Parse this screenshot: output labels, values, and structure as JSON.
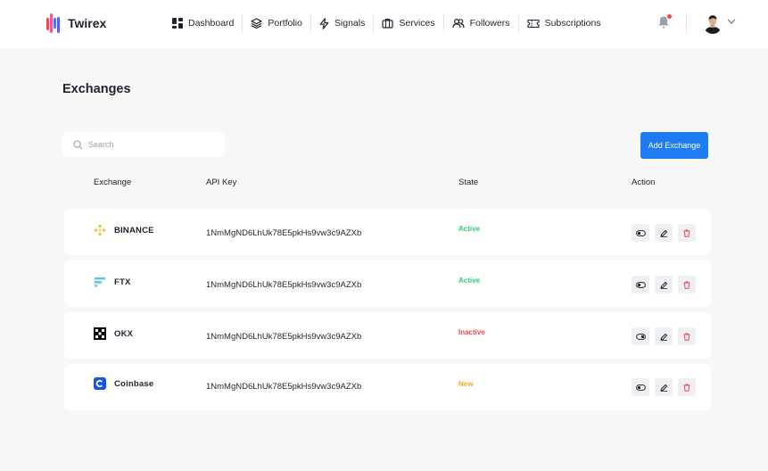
{
  "brand": {
    "name": "Twirex"
  },
  "nav": {
    "items": [
      {
        "label": "Dashboard",
        "icon": "dashboard-icon"
      },
      {
        "label": "Portfolio",
        "icon": "layers-icon"
      },
      {
        "label": "Signals",
        "icon": "lightning-icon"
      },
      {
        "label": "Services",
        "icon": "briefcase-icon"
      },
      {
        "label": "Followers",
        "icon": "users-icon"
      },
      {
        "label": "Subscriptions",
        "icon": "ticket-icon"
      }
    ]
  },
  "header": {
    "notification_icon": "bell-icon",
    "has_unread": true,
    "profile_icon": "avatar",
    "menu_icon": "chevron-down-icon"
  },
  "page": {
    "title": "Exchanges"
  },
  "search": {
    "placeholder": "Search",
    "value": ""
  },
  "toolbar": {
    "add_label": "Add Exchange"
  },
  "table": {
    "columns": [
      "Exchange",
      "API Key",
      "State",
      "Action"
    ],
    "rows": [
      {
        "exchange": "BINANCE",
        "logo": "binance-logo",
        "api_key": "1NmMgND6LhUk78E5pkHs9vw3c9AZXb",
        "state": "Active",
        "state_color": "#2ecc71"
      },
      {
        "exchange": "FTX",
        "logo": "ftx-logo",
        "api_key": "1NmMgND6LhUk78E5pkHs9vw3c9AZXb",
        "state": "Active",
        "state_color": "#2ecc71"
      },
      {
        "exchange": "OKX",
        "logo": "okx-logo",
        "api_key": "1NmMgND6LhUk78E5pkHs9vw3c9AZXb",
        "state": "Inactive",
        "state_color": "#f0484b"
      },
      {
        "exchange": "Coinbase",
        "logo": "coinbase-logo",
        "api_key": "1NmMgND6LhUk78E5pkHs9vw3c9AZXb",
        "state": "New",
        "state_color": "#f5a623"
      }
    ],
    "row_actions": [
      "toggle-icon",
      "edit-icon",
      "delete-icon"
    ]
  },
  "colors": {
    "accent": "#1e7bf2",
    "active": "#2ecc71",
    "inactive": "#f0484b",
    "new": "#f5a623",
    "delete": "#f0484b"
  }
}
